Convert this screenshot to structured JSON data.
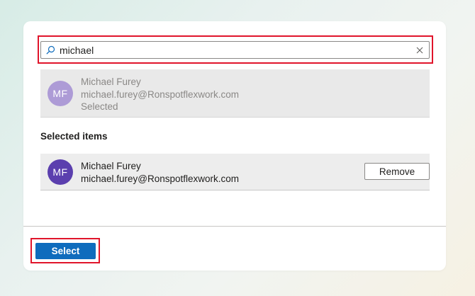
{
  "search": {
    "value": "michael",
    "icon": "search-icon",
    "clear_icon": "close-icon"
  },
  "search_result": {
    "initials": "MF",
    "name": "Michael Furey",
    "email": "michael.furey@Ronspotflexwork.com",
    "status": "Selected",
    "avatar_color": "#ad9bd6"
  },
  "selected_section": {
    "title": "Selected items",
    "items": [
      {
        "initials": "MF",
        "name": "Michael Furey",
        "email": "michael.furey@Ronspotflexwork.com",
        "avatar_color": "#5b3fae",
        "remove_label": "Remove"
      }
    ]
  },
  "footer": {
    "select_label": "Select",
    "select_color": "#0f6cbd"
  },
  "highlight_color": "#e0152b"
}
